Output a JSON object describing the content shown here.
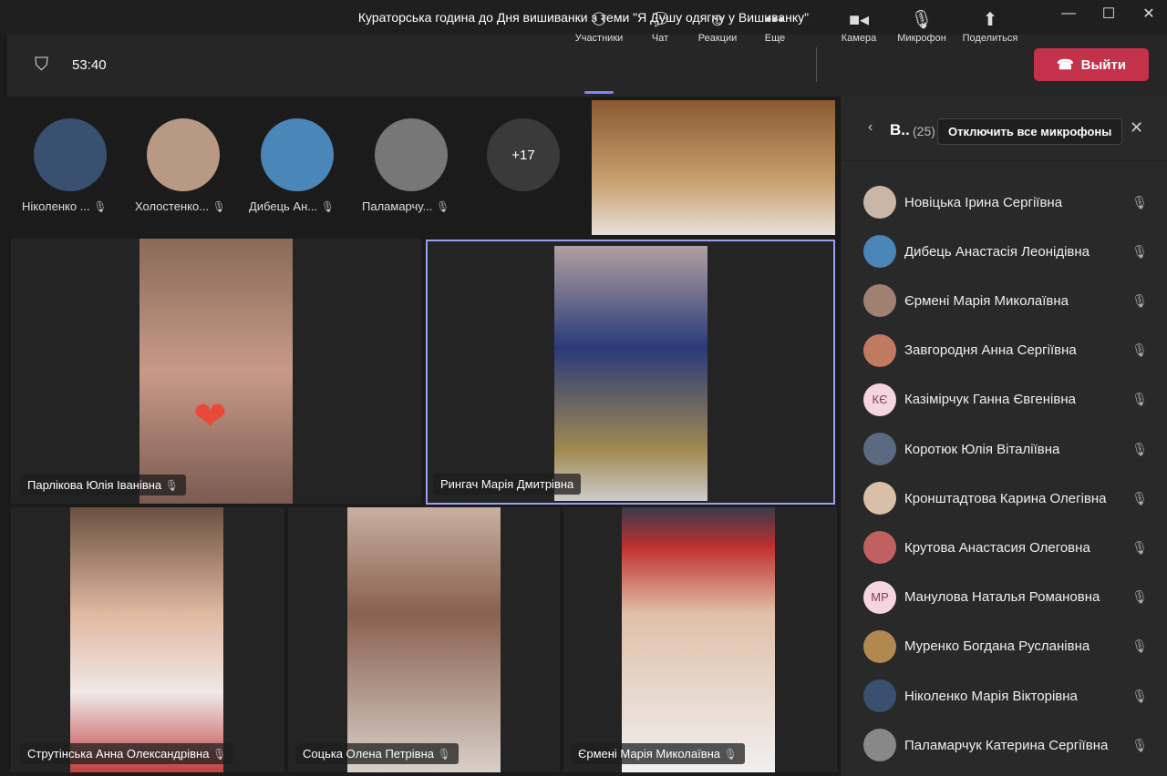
{
  "window": {
    "title": "Кураторська година до Дня вишиванки з теми \"Я Душу одягну у Вишиванку\""
  },
  "toolbar": {
    "timer": "53:40",
    "participants": "Участники",
    "chat": "Чат",
    "reactions": "Реакции",
    "more": "Еще",
    "camera": "Камера",
    "mic": "Микрофон",
    "share": "Поделиться",
    "leave": "Выйти"
  },
  "strip": {
    "people": [
      {
        "name": "Ніколенко ...",
        "color": "#3a5070"
      },
      {
        "name": "Холостенко...",
        "color": "#b89a84"
      },
      {
        "name": "Дибець Ан...",
        "color": "#4a86b8"
      },
      {
        "name": "Паламарчу...",
        "color": "#777"
      }
    ],
    "overflow": "+17"
  },
  "tiles": [
    {
      "name": "Парлікова Юлія Іванівна"
    },
    {
      "name": "Рингач Марія Дмитрівна"
    },
    {
      "name": "Струтінська Анна Олександрівна"
    },
    {
      "name": "Соцька Олена Петрівна"
    },
    {
      "name": "Єрмені Марія Миколаївна"
    }
  ],
  "panel": {
    "title": "В..",
    "count": "(25)",
    "mute_all": "Отключить все микрофоны",
    "items": [
      {
        "name": "Новіцька Ірина Сергіївна",
        "color": "#c9b6a6"
      },
      {
        "name": "Дибець Анастасія Леонідівна",
        "color": "#4a86b8"
      },
      {
        "name": "Єрмені Марія Миколаївна",
        "color": "#a08070"
      },
      {
        "name": "Завгородня Анна Сергіївна",
        "color": "#c07a60"
      },
      {
        "name": "Казімірчук Ганна Євгенівна",
        "initials": "КЄ",
        "color": "#f5d5de"
      },
      {
        "name": "Коротюк Юлія Віталіївна",
        "color": "#5a6a80"
      },
      {
        "name": "Кронштадтова Карина Олегівна",
        "color": "#d8c0a8"
      },
      {
        "name": "Крутова Анастасия Олеговна",
        "color": "#c06060"
      },
      {
        "name": "Манулова Наталья Романовна",
        "initials": "МР",
        "color": "#f5d5de"
      },
      {
        "name": "Муренко Богдана Русланівна",
        "color": "#b08850"
      },
      {
        "name": "Ніколенко Марія Вікторівна",
        "color": "#3a5070"
      },
      {
        "name": "Паламарчук Катерина Сергіївна",
        "color": "#888"
      }
    ]
  }
}
